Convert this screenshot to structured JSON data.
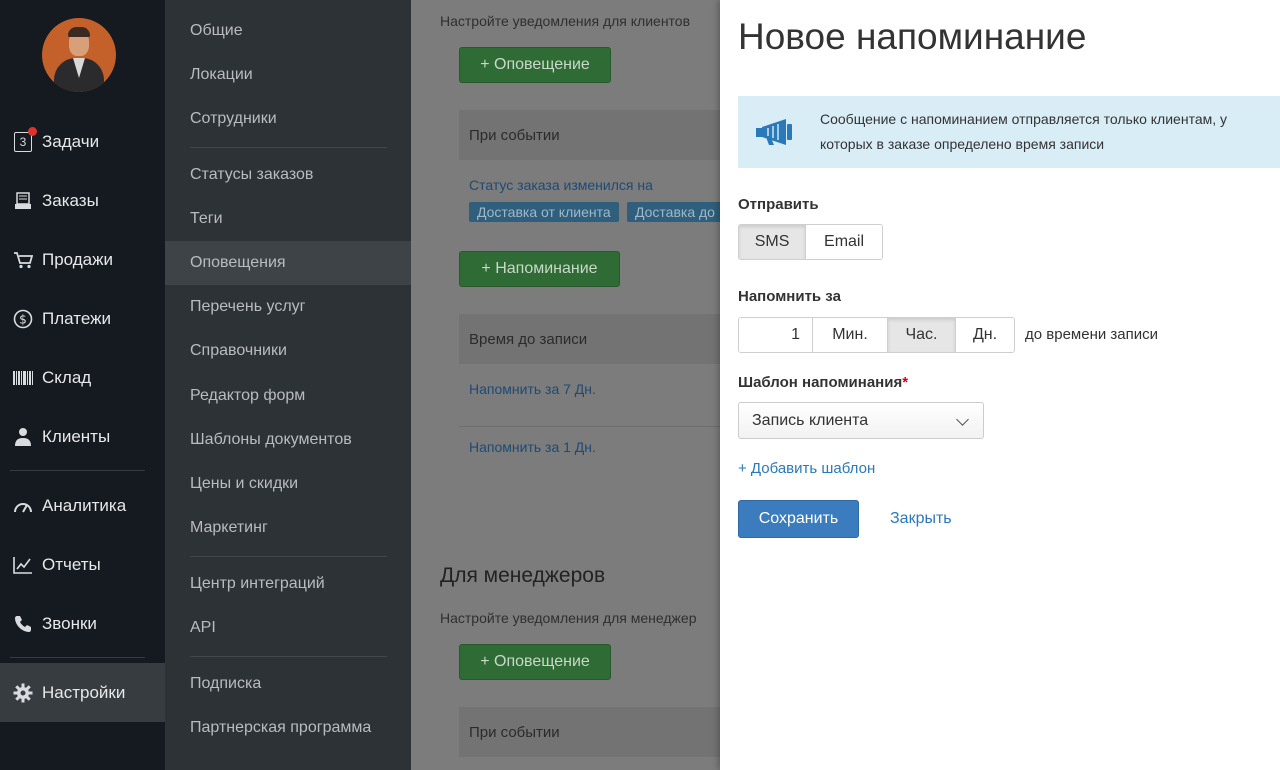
{
  "sidebar": {
    "items": [
      {
        "label": "Задачи",
        "icon": "tasks-icon",
        "badge": "3"
      },
      {
        "label": "Заказы",
        "icon": "orders-icon"
      },
      {
        "label": "Продажи",
        "icon": "cart-icon"
      },
      {
        "label": "Платежи",
        "icon": "dollar-icon"
      },
      {
        "label": "Склад",
        "icon": "barcode-icon"
      },
      {
        "label": "Клиенты",
        "icon": "user-icon"
      },
      {
        "label": "Аналитика",
        "icon": "gauge-icon"
      },
      {
        "label": "Отчеты",
        "icon": "chart-icon"
      },
      {
        "label": "Звонки",
        "icon": "phone-icon"
      },
      {
        "label": "Настройки",
        "icon": "gear-icon"
      }
    ]
  },
  "settings_nav": {
    "items": [
      "Общие",
      "Локации",
      "Сотрудники",
      "Статусы заказов",
      "Теги",
      "Оповещения",
      "Перечень услуг",
      "Справочники",
      "Редактор форм",
      "Шаблоны документов",
      "Цены и скидки",
      "Маркетинг",
      "Центр интеграций",
      "API",
      "Подписка",
      "Партнерская программа"
    ]
  },
  "main": {
    "clients_desc": "Настройте уведомления для клиентов",
    "add_notification": "+ Оповещение",
    "on_event_header": "При событии",
    "status_changed": "Статус заказа изменился на",
    "tags": [
      "Доставка от клиента",
      "Доставка до"
    ],
    "add_reminder": "+ Напоминание",
    "time_before_header": "Время до записи",
    "reminders": [
      "Напомнить за 7 Дн.",
      "Напомнить за 1 Дн."
    ],
    "managers_title": "Для менеджеров",
    "managers_desc": "Настройте уведомления для менеджер",
    "add_notification_2": "+ Оповещение",
    "on_event_header_2": "При событии"
  },
  "panel": {
    "title": "Новое напоминание",
    "info": "Сообщение с напоминанием отправляется только клиентам, у которых в заказе определено время записи",
    "send_label": "Отправить",
    "send_options": [
      "SMS",
      "Email"
    ],
    "send_selected": "SMS",
    "remind_label": "Напомнить за",
    "remind_value": "1",
    "units": [
      "Мин.",
      "Час.",
      "Дн."
    ],
    "unit_selected": "Час.",
    "after_text": "до времени записи",
    "template_label": "Шаблон напоминания",
    "required_mark": "*",
    "template_value": "Запись клиента",
    "add_template": "+ Добавить шаблон",
    "save": "Сохранить",
    "close": "Закрыть"
  },
  "colors": {
    "sidebar_bg": "#141a1f",
    "settings_bg": "#2d3236",
    "accent_blue": "#3a7cbd",
    "green_button": "#5cb85c",
    "info_bg": "#d9edf7",
    "required": "#d0021b"
  }
}
